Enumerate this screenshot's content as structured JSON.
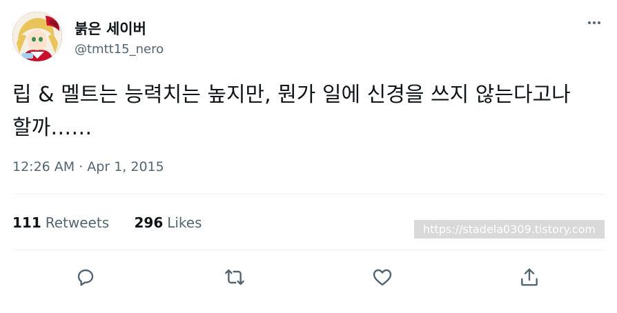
{
  "author": {
    "display_name": "붉은 세이버",
    "username": "@tmtt15_nero"
  },
  "tweet": {
    "text": "립 & 멜트는 능력치는 높지만, 뭔가 일에 신경을 쓰지 않는다고나 할까……",
    "timestamp": "12:26 AM · Apr 1, 2015"
  },
  "stats": {
    "retweets_count": "111",
    "retweets_label": "Retweets",
    "likes_count": "296",
    "likes_label": "Likes"
  },
  "watermark": "https://stadela0309.tistory.com",
  "icons": {
    "more": "more-horizontal-icon",
    "reply": "reply-icon",
    "retweet": "retweet-icon",
    "like": "heart-icon",
    "share": "share-icon"
  },
  "colors": {
    "text_primary": "#0f1419",
    "text_secondary": "#536471",
    "divider": "#eff3f4",
    "background": "#ffffff"
  }
}
